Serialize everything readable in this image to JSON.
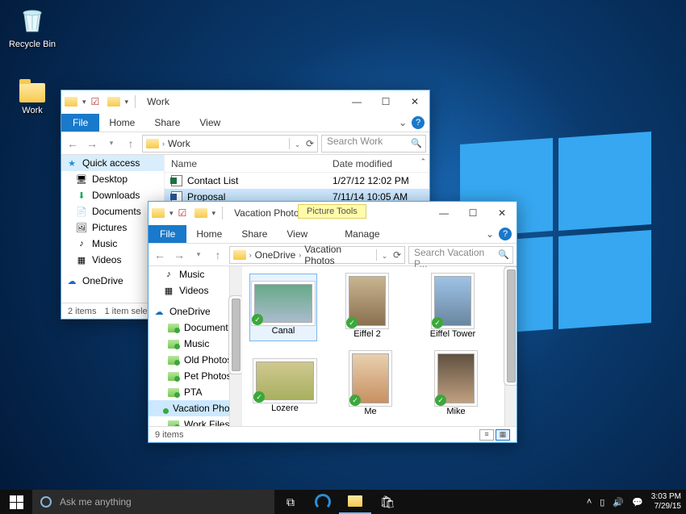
{
  "desktop": {
    "icons": {
      "recycle": "Recycle Bin",
      "work": "Work"
    }
  },
  "work_window": {
    "title": "Work",
    "menus": {
      "file": "File",
      "home": "Home",
      "share": "Share",
      "view": "View"
    },
    "breadcrumb": [
      "Work"
    ],
    "search_placeholder": "Search Work",
    "sidebar": {
      "quick": "Quick access",
      "items": [
        "Desktop",
        "Downloads",
        "Documents",
        "Pictures",
        "Music",
        "Videos"
      ],
      "onedrive": "OneDrive"
    },
    "columns": {
      "name": "Name",
      "date": "Date modified"
    },
    "rows": [
      {
        "name": "Contact List",
        "date": "1/27/12 12:02 PM",
        "type": "xl"
      },
      {
        "name": "Proposal",
        "date": "7/11/14 10:05 AM",
        "type": "wd"
      }
    ],
    "status": {
      "count": "2 items",
      "sel": "1 item sele"
    }
  },
  "photos_window": {
    "title": "Vacation Photos",
    "pic_tools": "Picture Tools",
    "manage": "Manage",
    "menus": {
      "file": "File",
      "home": "Home",
      "share": "Share",
      "view": "View"
    },
    "breadcrumb": [
      "OneDrive",
      "Vacation Photos"
    ],
    "search_placeholder": "Search Vacation P...",
    "sidebar": {
      "music": "Music",
      "videos": "Videos",
      "onedrive": "OneDrive",
      "folders": [
        "Documents",
        "Music",
        "Old Photos",
        "Pet Photos",
        "PTA",
        "Vacation Photos",
        "Work Files"
      ]
    },
    "photos": [
      {
        "name": "Canal",
        "cls": "t-canal wide",
        "sel": true
      },
      {
        "name": "Eiffel 2",
        "cls": "t-eif tall"
      },
      {
        "name": "Eiffel Tower",
        "cls": "t-eift tall"
      },
      {
        "name": "Lozere",
        "cls": "t-loz wide"
      },
      {
        "name": "Me",
        "cls": "t-me tall"
      },
      {
        "name": "Mike",
        "cls": "t-mike tall"
      }
    ],
    "status": {
      "count": "9 items"
    }
  },
  "taskbar": {
    "cortana_placeholder": "Ask me anything",
    "time": "3:03 PM",
    "date": "7/29/15"
  }
}
